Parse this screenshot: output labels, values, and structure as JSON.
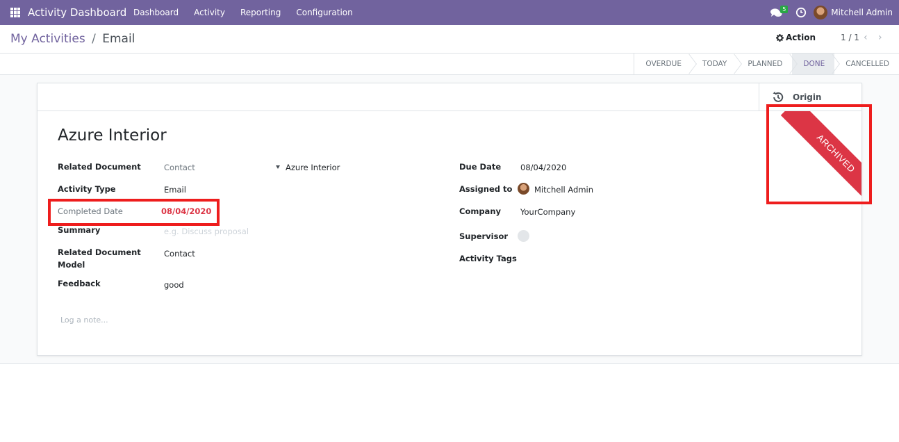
{
  "navbar": {
    "app_title": "Activity Dashboard",
    "menu": [
      "Dashboard",
      "Activity",
      "Reporting",
      "Configuration"
    ],
    "chat_badge": "5",
    "user_name": "Mitchell Admin",
    "bg_color": "#71639e"
  },
  "breadcrumb": {
    "parent": "My Activities",
    "separator": "/",
    "current": "Email"
  },
  "control": {
    "action_label": "Action",
    "pager": "1 / 1"
  },
  "stages": [
    {
      "label": "OVERDUE",
      "active": false
    },
    {
      "label": "TODAY",
      "active": false
    },
    {
      "label": "PLANNED",
      "active": false
    },
    {
      "label": "DONE",
      "active": true
    },
    {
      "label": "CANCELLED",
      "active": false
    }
  ],
  "sheet": {
    "origin_label": "Origin",
    "ribbon_text": "ARCHIVED",
    "title": "Azure Interior",
    "left_fields": {
      "related_document_label": "Related Document",
      "related_document_model": "Contact",
      "related_document_record": "Azure Interior",
      "activity_type_label": "Activity Type",
      "activity_type_value": "Email",
      "completed_date_label": "Completed Date",
      "completed_date_value": "08/04/2020",
      "summary_label": "Summary",
      "summary_placeholder": "e.g. Discuss proposal",
      "rel_doc_model_label_line1": "Related Document",
      "rel_doc_model_label_line2": "Model",
      "rel_doc_model_value": "Contact",
      "feedback_label": "Feedback",
      "feedback_value": "good"
    },
    "right_fields": {
      "due_date_label": "Due Date",
      "due_date_value": "08/04/2020",
      "assigned_to_label": "Assigned to",
      "assigned_to_value": "Mitchell Admin",
      "company_label": "Company",
      "company_value": "YourCompany",
      "supervisor_label": "Supervisor",
      "activity_tags_label": "Activity Tags"
    },
    "note_placeholder": "Log a note..."
  },
  "accent_colors": {
    "highlight": "#ee1d1d",
    "ribbon": "#dc3545",
    "completed_date": "#dc3545"
  }
}
